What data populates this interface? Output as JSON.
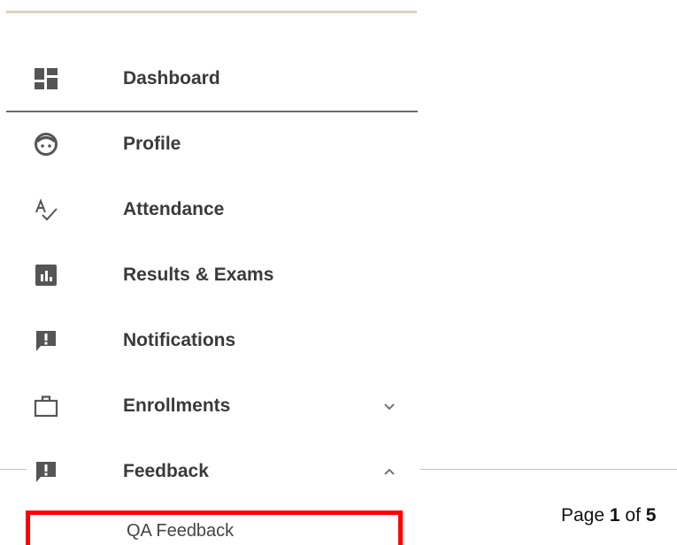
{
  "menu": {
    "items": [
      {
        "label": "Dashboard",
        "icon": "dashboard-icon"
      },
      {
        "label": "Profile",
        "icon": "face-icon"
      },
      {
        "label": "Attendance",
        "icon": "spellcheck-icon"
      },
      {
        "label": "Results & Exams",
        "icon": "bar-chart-icon"
      },
      {
        "label": "Notifications",
        "icon": "feedback-icon"
      },
      {
        "label": "Enrollments",
        "icon": "briefcase-icon",
        "chevron": "chevron-down-icon"
      },
      {
        "label": "Feedback",
        "icon": "feedback-icon",
        "chevron": "chevron-up-icon"
      }
    ],
    "submenu": {
      "label": "QA Feedback"
    }
  },
  "footer": {
    "page_prefix": "Page ",
    "page_current": "1",
    "page_middle": " of ",
    "page_total": "5"
  },
  "colors": {
    "icon": "#555555",
    "label": "#3a3a3a",
    "highlight_border": "#ff0000",
    "top_rule": "#d9d2bd"
  }
}
